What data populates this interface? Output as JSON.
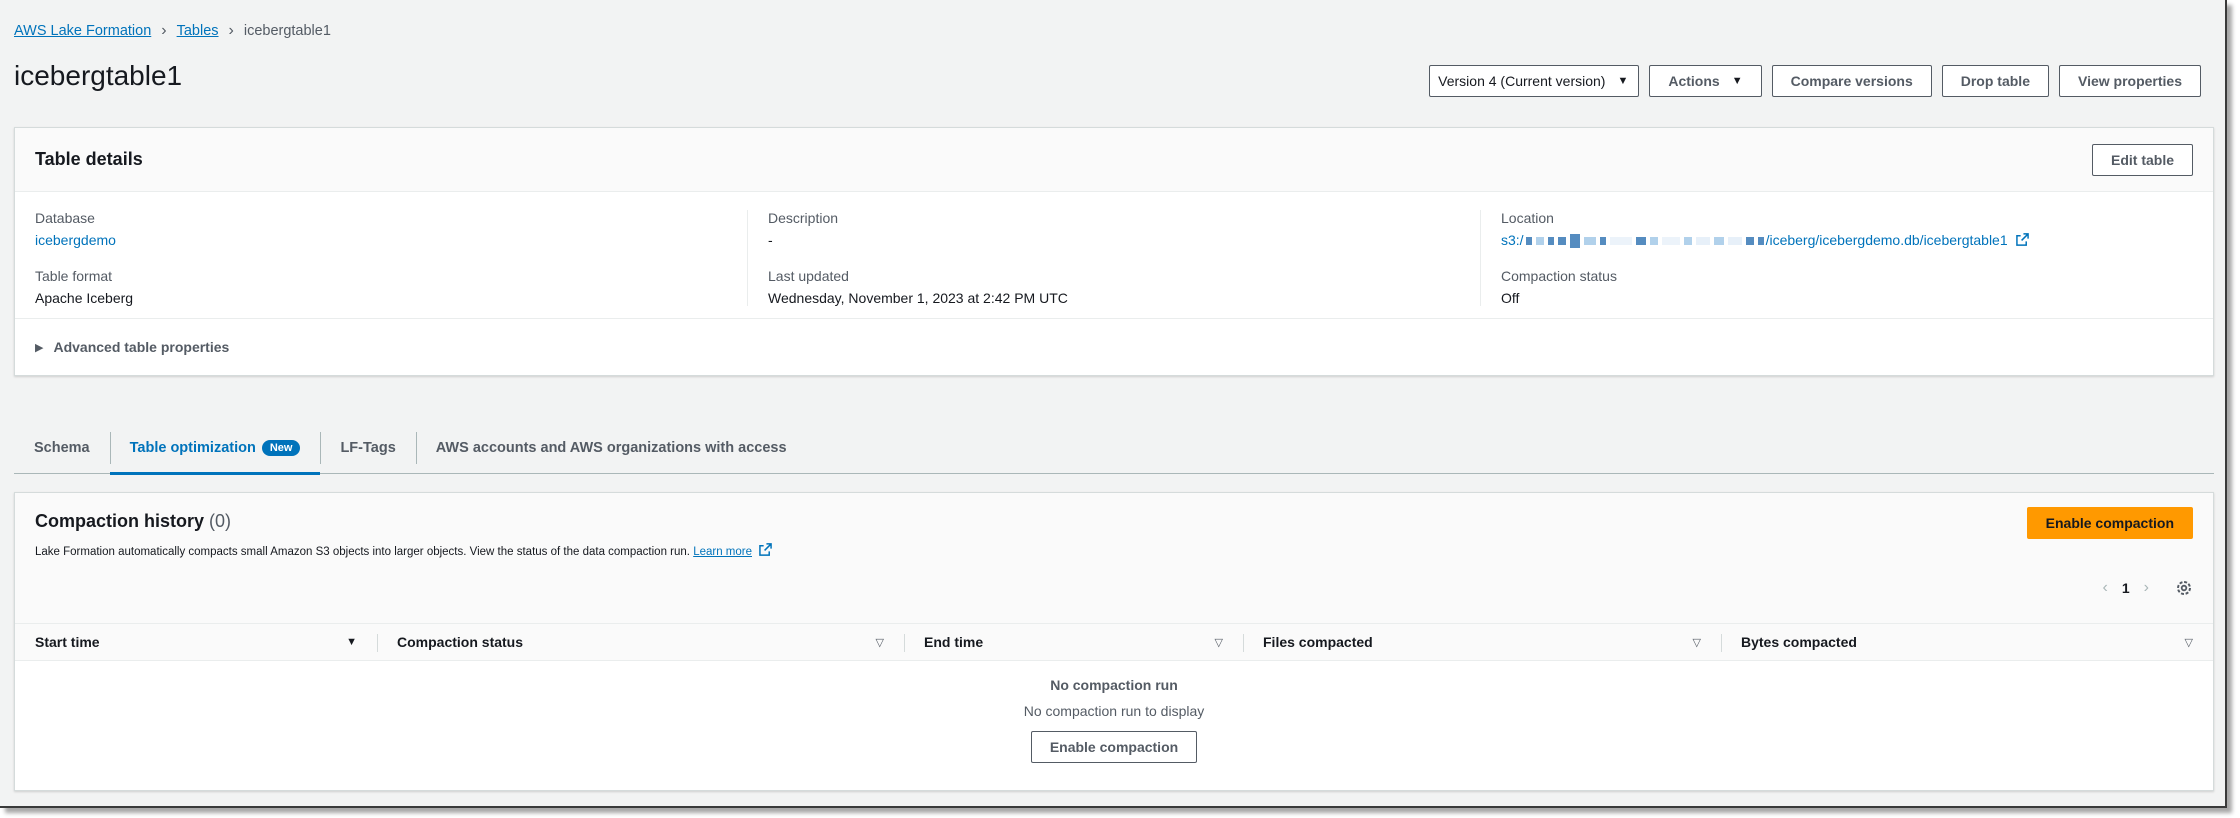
{
  "breadcrumb": {
    "root": "AWS Lake Formation",
    "tables": "Tables",
    "current": "icebergtable1"
  },
  "page": {
    "title": "icebergtable1"
  },
  "header_actions": {
    "version": "Version 4 (Current version)",
    "actions": "Actions",
    "compare": "Compare versions",
    "drop": "Drop table",
    "view_properties": "View properties"
  },
  "details": {
    "title": "Table details",
    "edit": "Edit table",
    "database_label": "Database",
    "database_value": "icebergdemo",
    "format_label": "Table format",
    "format_value": "Apache Iceberg",
    "description_label": "Description",
    "description_value": "-",
    "updated_label": "Last updated",
    "updated_value": "Wednesday, November 1, 2023 at 2:42 PM UTC",
    "location_label": "Location",
    "location_prefix": "s3:/",
    "location_suffix": "/iceberg/icebergdemo.db/icebergtable1",
    "compaction_label": "Compaction status",
    "compaction_value": "Off",
    "advanced": "Advanced table properties"
  },
  "tabs": [
    {
      "label": "Schema"
    },
    {
      "label": "Table optimization",
      "badge": "New"
    },
    {
      "label": "LF-Tags"
    },
    {
      "label": "AWS accounts and AWS organizations with access"
    }
  ],
  "compaction": {
    "title": "Compaction history",
    "count": "(0)",
    "description": "Lake Formation automatically compacts small Amazon S3 objects into larger objects. View the status of the data compaction run.",
    "learn_more": "Learn more",
    "enable": "Enable compaction",
    "page_number": "1",
    "columns": [
      "Start time",
      "Compaction status",
      "End time",
      "Files compacted",
      "Bytes compacted"
    ],
    "empty_title": "No compaction run",
    "empty_sub": "No compaction run to display",
    "empty_button": "Enable compaction"
  },
  "colors": {
    "link": "#0073bb",
    "primary": "#ff9900",
    "background": "#f2f3f3"
  }
}
